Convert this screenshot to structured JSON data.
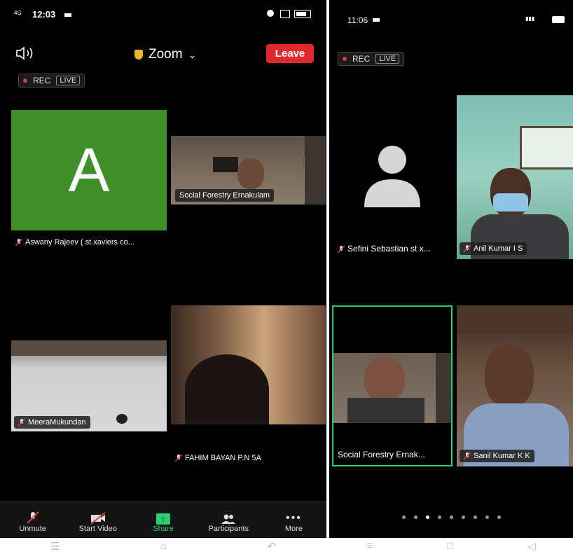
{
  "left_phone": {
    "status": {
      "time": "12:03",
      "network": "4G",
      "icons": [
        "video-icon",
        "alarm-icon",
        "signal-icon",
        "battery-icon"
      ]
    },
    "header": {
      "speaker_icon": "speaker-icon",
      "title": "Zoom",
      "shield_icon": "shield-icon",
      "leave": "Leave"
    },
    "rec": {
      "label": "REC",
      "live": "LIVE"
    },
    "avatar_letter": "A",
    "participants": [
      {
        "name": "Aswany Rajeev ( st.xaviers co...",
        "muted": true
      },
      {
        "name": "Social Forestry Ernakulam",
        "muted": false
      },
      {
        "name": "MeeraMukundan",
        "muted": true
      },
      {
        "name": "FAHIM BAYAN P.N 5A",
        "muted": true
      }
    ],
    "toolbar": [
      {
        "label": "Unmute",
        "icon": "mic-muted-icon"
      },
      {
        "label": "Start Video",
        "icon": "video-off-icon"
      },
      {
        "label": "Share",
        "icon": "share-icon"
      },
      {
        "label": "Participants",
        "icon": "participants-icon"
      },
      {
        "label": "More",
        "icon": "more-icon"
      }
    ],
    "nav": [
      "menu-icon",
      "home-icon",
      "back-icon"
    ],
    "colors": {
      "avatar_bg": "#3f8f2a",
      "leave_bg": "#e0282e",
      "share_accent": "#2ecc71"
    }
  },
  "right_phone": {
    "status": {
      "time": "11:06"
    },
    "rec": {
      "label": "REC",
      "live": "LIVE"
    },
    "participants": [
      {
        "name": "Sefini Sebastian st x...",
        "muted": true
      },
      {
        "name": "Anil Kumar I S",
        "muted": true
      },
      {
        "name": "Social Forestry Ernak...",
        "muted": false,
        "active_speaker": true
      },
      {
        "name": "Sanil Kumar K K",
        "muted": true
      }
    ],
    "page_dots": {
      "count": 9,
      "active": 3
    },
    "nav": [
      "menu-icon",
      "square-icon",
      "back-icon"
    ]
  }
}
